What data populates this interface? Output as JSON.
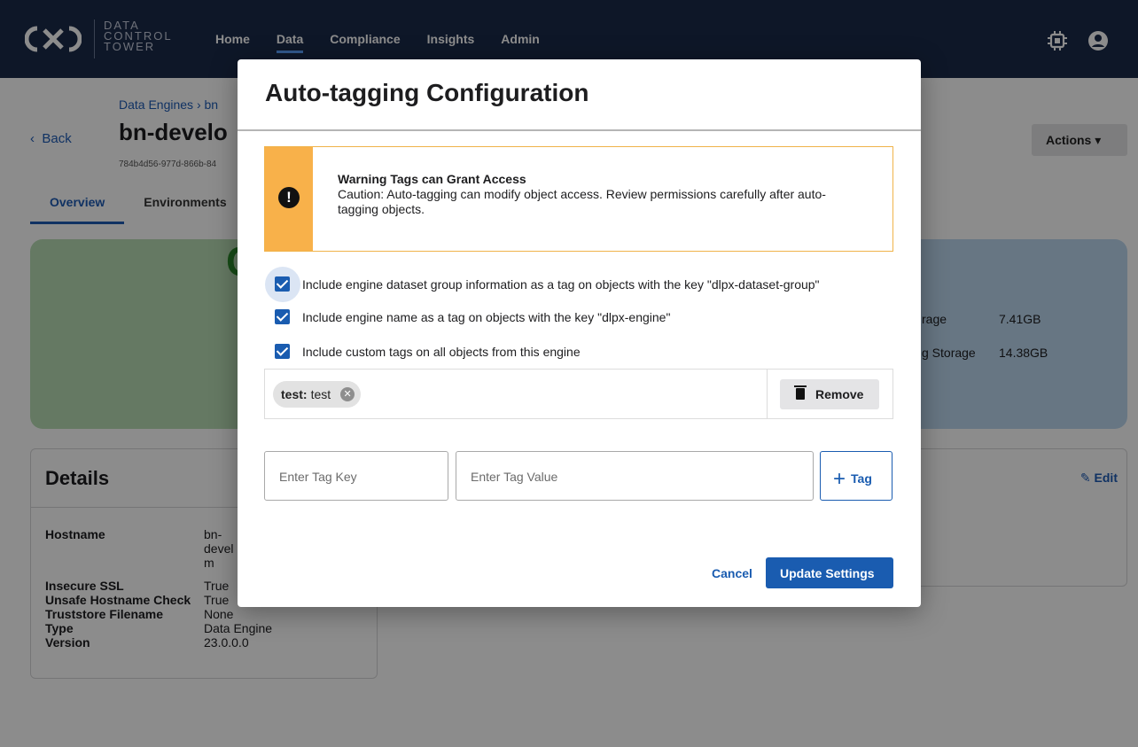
{
  "app": {
    "logo_lines": [
      "DATA",
      "CONTROL",
      "TOWER"
    ],
    "nav": [
      "Home",
      "Data",
      "Compliance",
      "Insights",
      "Admin"
    ],
    "active_nav": "Data",
    "icons": [
      "cpu-chip-icon",
      "user-account-icon"
    ]
  },
  "page": {
    "back_label": "Back",
    "breadcrumb": "Data Engines  ›  bn",
    "engine_title": "bn-develo",
    "engine_id": "784b4d56-977d-866b-84",
    "tabs": [
      "Overview",
      "Environments"
    ],
    "actions_label": "Actions ▾",
    "status_letter": "C",
    "storage": [
      {
        "label": "rage",
        "value": "7.41GB"
      },
      {
        "label": "g Storage",
        "value": "14.38GB"
      }
    ],
    "details": {
      "title": "Details",
      "edit_label": "Edit",
      "rows": [
        {
          "label": "Hostname",
          "value": "bn-\ndevel\nm"
        },
        {
          "label": "Insecure SSL",
          "value": "True"
        },
        {
          "label": "Unsafe Hostname Check",
          "value": "True"
        },
        {
          "label": "Truststore Filename",
          "value": "None"
        },
        {
          "label": "Type",
          "value": "Data Engine"
        },
        {
          "label": "Version",
          "value": "23.0.0.0"
        }
      ]
    }
  },
  "modal": {
    "title": "Auto-tagging Configuration",
    "warning": {
      "title": "Warning Tags can Grant Access",
      "text": "Caution: Auto-tagging can modify object access. Review permissions carefully after auto-tagging objects."
    },
    "checkboxes": [
      {
        "label": "Include engine dataset group information as a tag on objects with the key \"dlpx-dataset-group\"",
        "checked": true
      },
      {
        "label": "Include engine name as a tag on objects with the key \"dlpx-engine\"",
        "checked": true
      },
      {
        "label": "Include custom tags on all objects from this engine",
        "checked": true
      }
    ],
    "tag": {
      "key": "test:",
      "value": "test"
    },
    "remove_label": "Remove",
    "tag_key_placeholder": "Enter Tag Key",
    "tag_value_placeholder": "Enter Tag Value",
    "add_tag_label": "Tag",
    "cancel_label": "Cancel",
    "update_label": "Update Settings"
  },
  "colors": {
    "topbar": "#1b2a4a",
    "primary": "#1a5cb0",
    "warning": "#f8b14a"
  }
}
